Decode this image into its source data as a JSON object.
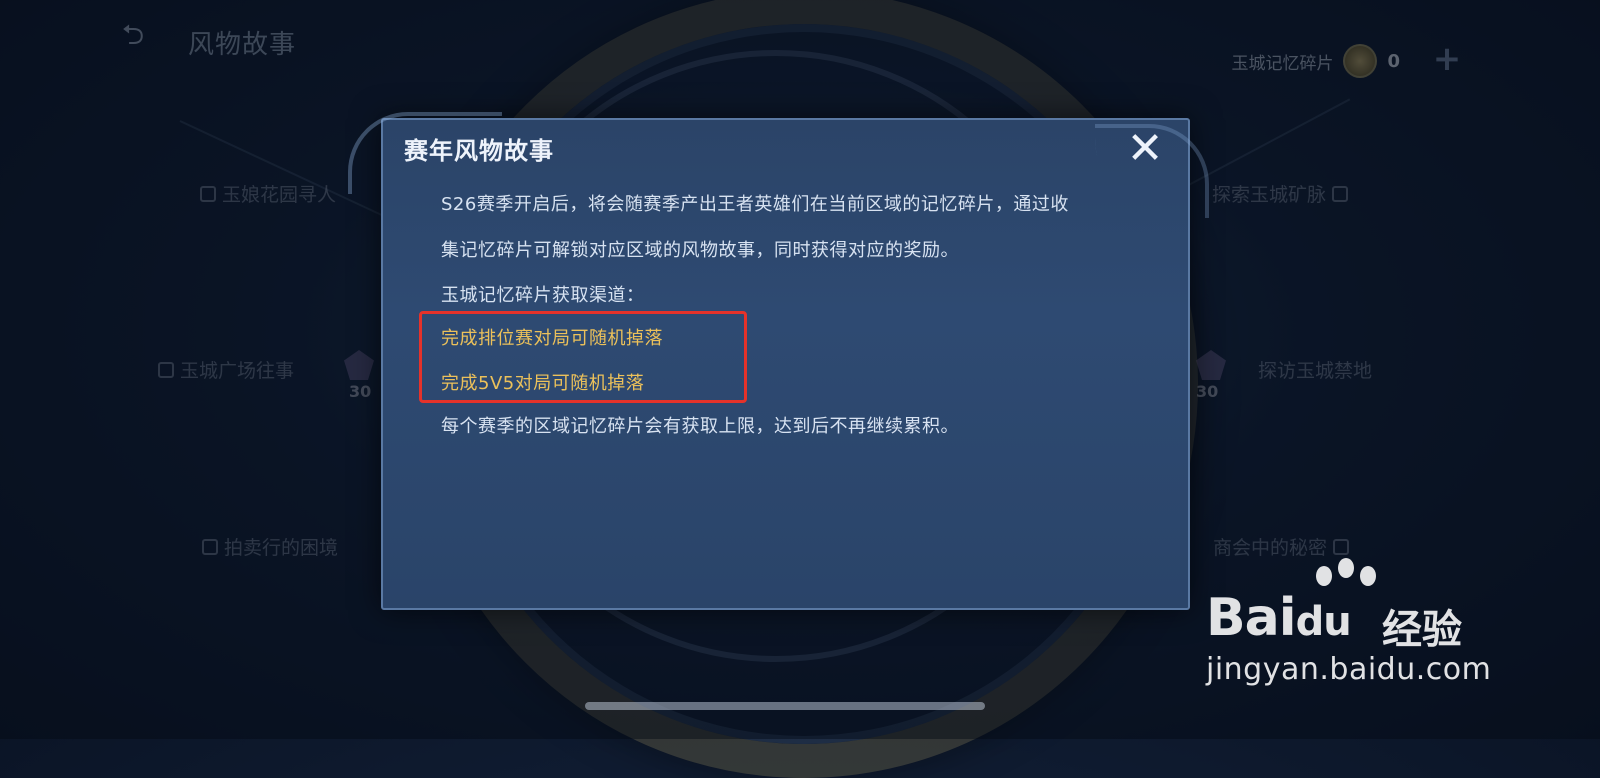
{
  "header": {
    "back_icon": "back-arrow-icon",
    "title": "风物故事"
  },
  "currency": {
    "label": "玉城记忆碎片",
    "icon": "coin-icon",
    "count": "0",
    "add_icon": "plus-icon"
  },
  "background_nodes": [
    {
      "label": "玉娘花园寻人"
    },
    {
      "label": "探索玉城矿脉"
    },
    {
      "label": "玉城广场往事"
    },
    {
      "label": "探访玉城禁地"
    },
    {
      "label": "拍卖行的困境"
    },
    {
      "label": "商会中的秘密"
    }
  ],
  "gems": [
    {
      "count": "30"
    },
    {
      "count": "30"
    }
  ],
  "dialog": {
    "title": "赛年风物故事",
    "close_icon": "close-icon",
    "paragraphs": {
      "intro_line1": "S26赛季开启后，将会随赛季产出王者英雄们在当前区域的记忆碎片，通过收",
      "intro_line2": "集记忆碎片可解锁对应区域的风物故事，同时获得对应的奖励。",
      "channels_heading": "玉城记忆碎片获取渠道：",
      "channel1": "完成排位赛对局可随机掉落",
      "channel2": "完成5V5对局可随机掉落",
      "limit_note": "每个赛季的区域记忆碎片会有获取上限，达到后不再继续累积。"
    }
  },
  "watermark": {
    "brand": "Bai",
    "brand_du": "du",
    "brand_cn": "经验",
    "url": "jingyan.baidu.com"
  },
  "colors": {
    "dialog_bg": "#2e4a72",
    "highlight": "#ecc15a",
    "annotation_red": "#e5322a"
  }
}
